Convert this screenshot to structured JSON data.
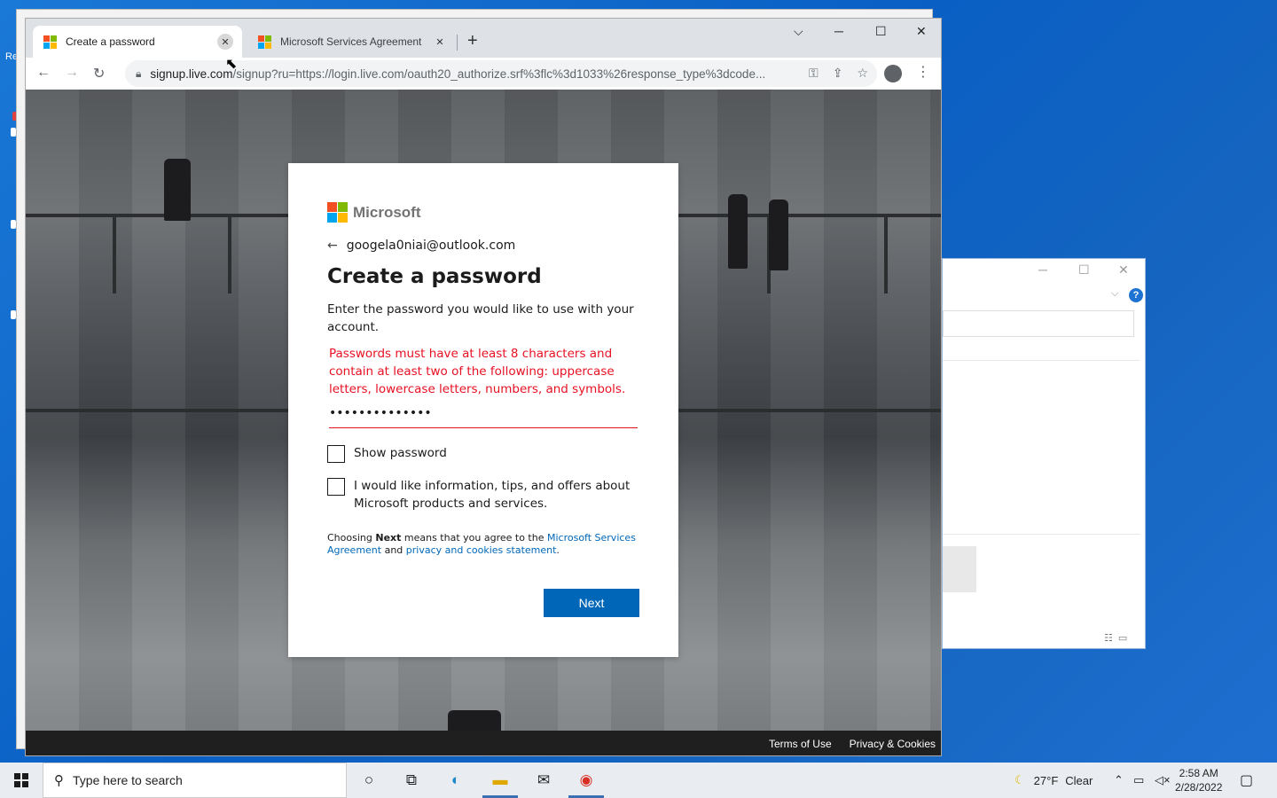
{
  "desktop": {
    "edge_text": "Re"
  },
  "browser": {
    "tabs": [
      {
        "title": "Create a password",
        "active": true
      },
      {
        "title": "Microsoft Services Agreement",
        "active": false
      }
    ],
    "address": {
      "host": "signup.live.com",
      "path": "/signup?ru=https://login.live.com/oauth20_authorize.srf%3flc%3d1033%26response_type%3dcode..."
    }
  },
  "signup": {
    "brand": "Microsoft",
    "identity": "googela0niai@outlook.com",
    "heading": "Create a password",
    "description": "Enter the password you would like to use with your account.",
    "error": "Passwords must have at least 8 characters and contain at least two of the following: uppercase letters, lowercase letters, numbers, and symbols.",
    "password_mask": "••••••••••••••",
    "show_password_label": "Show password",
    "offers_label": "I would like information, tips, and offers about Microsoft products and services.",
    "legal": {
      "prefix": "Choosing ",
      "bold": "Next",
      "middle": " means that you agree to the ",
      "link1": "Microsoft Services Agreement",
      "and": " and ",
      "link2": "privacy and cookies statement",
      "end": "."
    },
    "next_label": "Next"
  },
  "page_footer": {
    "terms": "Terms of Use",
    "privacy": "Privacy & Cookies"
  },
  "taskbar": {
    "search_placeholder": "Type here to search",
    "weather_temp": "27°F",
    "weather_desc": "Clear",
    "time": "2:58 AM",
    "date": "2/28/2022"
  },
  "colors": {
    "ms_red": "#f25022",
    "ms_green": "#7fba00",
    "ms_blue": "#00a4ef",
    "ms_yellow": "#ffb900",
    "error_red": "#e81123",
    "button_blue": "#0067b8"
  }
}
